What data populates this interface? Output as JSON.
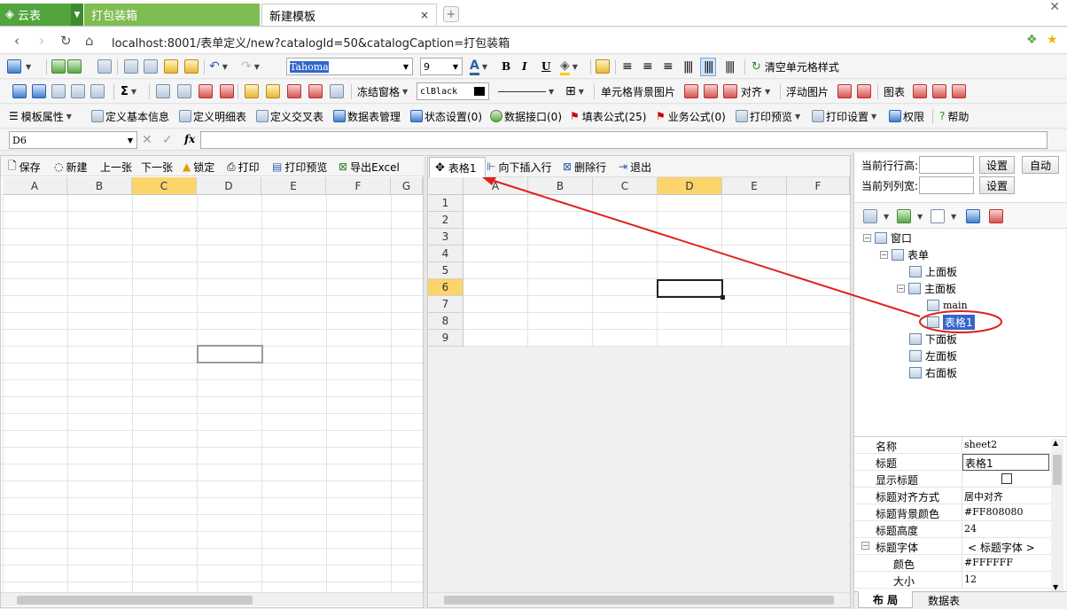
{
  "tabs": {
    "brand": "云表",
    "tab1": "打包装箱",
    "tab2": "新建模板",
    "close": "×",
    "new_tab": "+"
  },
  "address": {
    "url": "localhost:8001/表单定义/new?catalogId=50&catalogCaption=打包装箱"
  },
  "toolbar1": {
    "font_name": "Tahoma",
    "font_size": "9",
    "bold": "B",
    "italic": "I",
    "underline": "U",
    "clear_style": "清空单元格样式"
  },
  "toolbar2": {
    "sum": "Σ",
    "freeze": "冻结窗格",
    "color_value": "clBlack",
    "cell_bg_image": "单元格背景图片",
    "align": "对齐",
    "float_image": "浮动图片",
    "chart": "图表"
  },
  "toolbar3": {
    "template_props": "模板属性",
    "define_basic": "定义基本信息",
    "define_detail": "定义明细表",
    "define_cross": "定义交叉表",
    "data_table_mgmt": "数据表管理",
    "status_settings": "状态设置(0)",
    "data_interface": "数据接口(0)",
    "fill_formula": "填表公式(25)",
    "business_formula": "业务公式(0)",
    "print_preview": "打印预览",
    "print_settings": "打印设置",
    "permission": "权限",
    "help": "帮助"
  },
  "formula_bar": {
    "cell_ref": "D6",
    "fx": "fx"
  },
  "left_toolbar": {
    "save": "保存",
    "new": "新建",
    "prev": "上一张",
    "next": "下一张",
    "lock": "锁定",
    "print": "打印",
    "print_preview": "打印预览",
    "export_excel": "导出Excel"
  },
  "left_grid": {
    "columns": [
      "A",
      "B",
      "C",
      "D",
      "E",
      "F",
      "G"
    ]
  },
  "mid_toolbar": {
    "handle": "表格1",
    "insert_row": "向下插入行",
    "delete_row": "删除行",
    "exit": "退出"
  },
  "mid_grid": {
    "columns": [
      "A",
      "B",
      "C",
      "D",
      "E",
      "F"
    ],
    "rows": [
      "1",
      "2",
      "3",
      "4",
      "5",
      "6",
      "7",
      "8",
      "9"
    ]
  },
  "size_panel": {
    "row_height_label": "当前行行高:",
    "col_width_label": "当前列列宽:",
    "set": "设置",
    "auto": "自动"
  },
  "tree": {
    "window": "窗口",
    "form": "表单",
    "top_panel": "上面板",
    "main_panel": "主面板",
    "main": "main",
    "table1": "表格1",
    "bottom_panel": "下面板",
    "left_panel": "左面板",
    "right_panel": "右面板"
  },
  "props": [
    {
      "key": "名称",
      "value": "sheet2"
    },
    {
      "key": "标题",
      "value": "表格1"
    },
    {
      "key": "显示标题",
      "value": ""
    },
    {
      "key": "标题对齐方式",
      "value": "居中对齐"
    },
    {
      "key": "标题背景颜色",
      "value": "#FF808080"
    },
    {
      "key": "标题高度",
      "value": "24"
    },
    {
      "key": "标题字体",
      "value": "< 标题字体 >"
    },
    {
      "key": "颜色",
      "value": "#FFFFFF"
    },
    {
      "key": "大小",
      "value": "12"
    }
  ],
  "bottom_tabs": {
    "layout": "布 局",
    "data_table": "数据表"
  },
  "colors": {
    "brand_green": "#52a43c",
    "selection_yellow": "#fbd46b",
    "annotation_red": "#e02020"
  }
}
